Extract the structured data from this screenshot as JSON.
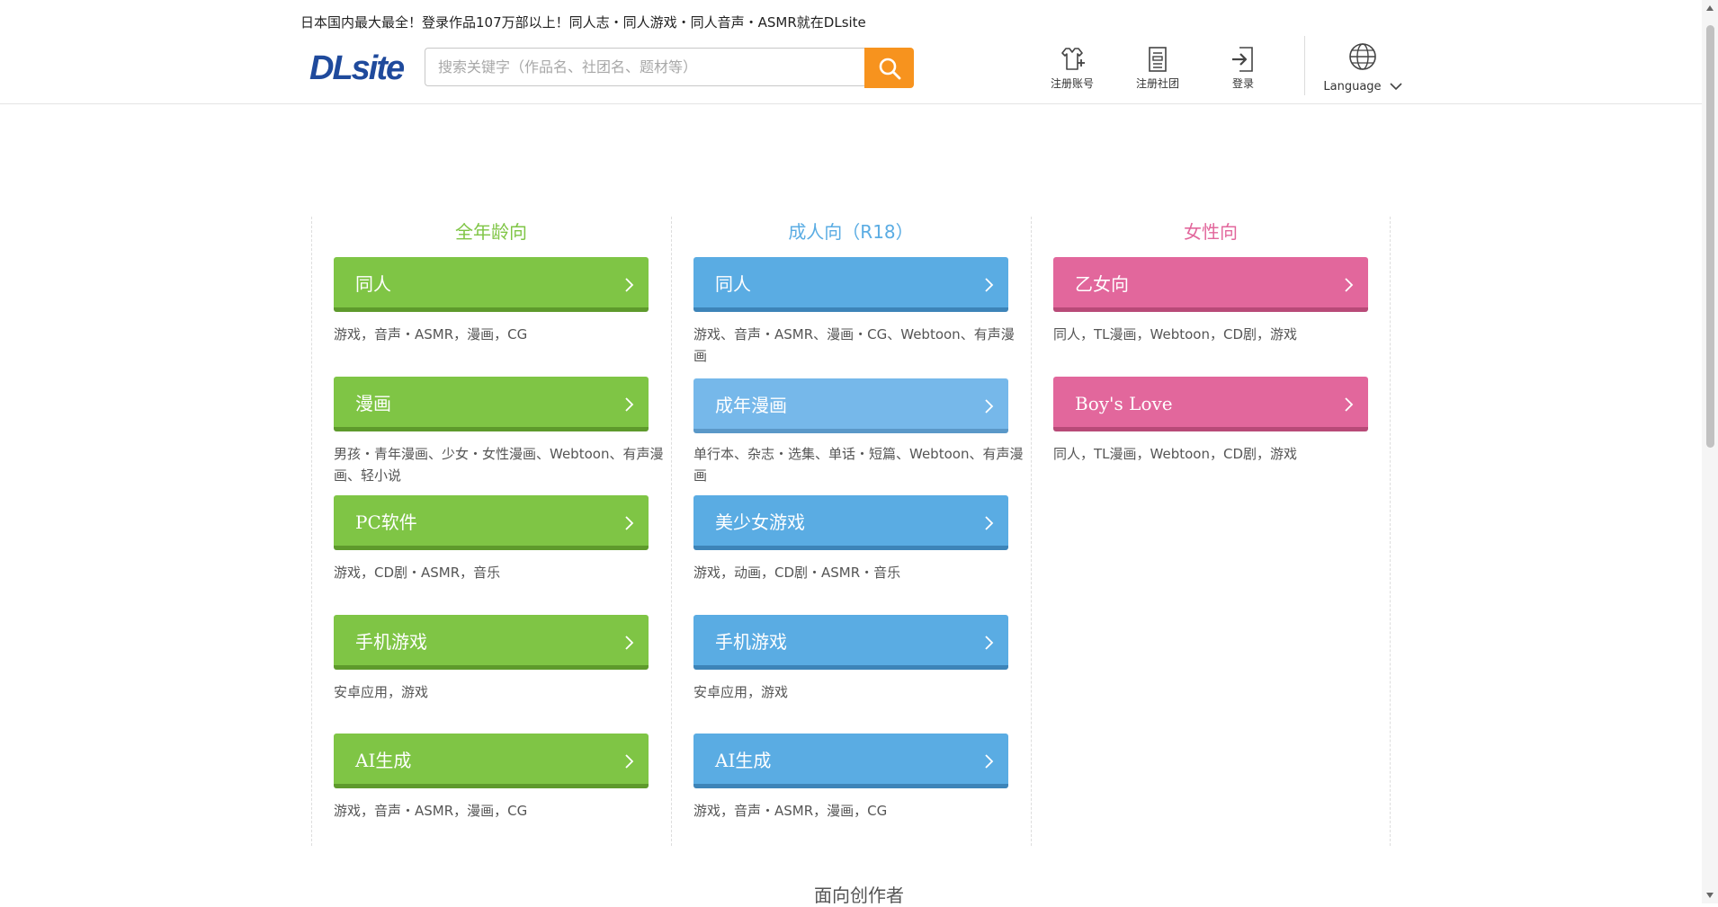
{
  "header": {
    "tagline": "日本国内最大最全！登录作品107万部以上！同人志・同人游戏・同人音声・ASMR就在DLsite",
    "logo_text": "DLsite",
    "search": {
      "placeholder": "搜索关键字（作品名、社团名、题材等）",
      "value": ""
    },
    "buttons": {
      "register_account": "注册账号",
      "register_circle": "注册社团",
      "login": "登录"
    },
    "language_label": "Language"
  },
  "columns": [
    {
      "title": "全年龄向",
      "title_color": "#7fc545",
      "items": [
        {
          "label": "同人",
          "desc": "游戏，音声・ASMR，漫画，CG"
        },
        {
          "label": "漫画",
          "desc": "男孩・青年漫画、少女・女性漫画、Webtoon、有声漫画、轻小说"
        },
        {
          "label": "PC软件",
          "desc": "游戏，CD剧・ASMR，音乐"
        },
        {
          "label": "手机游戏",
          "desc": "安卓应用，游戏"
        },
        {
          "label": "AI生成",
          "desc": "游戏，音声・ASMR，漫画，CG"
        }
      ]
    },
    {
      "title": "成人向（R18）",
      "title_color": "#5aace3",
      "items": [
        {
          "label": "同人",
          "desc": "游戏、音声・ASMR、漫画・CG、Webtoon、有声漫画"
        },
        {
          "label": "成年漫画",
          "desc": "单行本、杂志・选集、单话・短篇、Webtoon、有声漫画"
        },
        {
          "label": "美少女游戏",
          "desc": "游戏，动画，CD剧・ASMR・音乐"
        },
        {
          "label": "手机游戏",
          "desc": "安卓应用，游戏"
        },
        {
          "label": "AI生成",
          "desc": "游戏，音声・ASMR，漫画，CG"
        }
      ]
    },
    {
      "title": "女性向",
      "title_color": "#e2679c",
      "items": [
        {
          "label": "乙女向",
          "desc": "同人，TL漫画，Webtoon，CD剧，游戏"
        },
        {
          "label": "Boy's Love",
          "desc": "同人，TL漫画，Webtoon，CD剧，游戏"
        }
      ]
    }
  ],
  "creators_heading": "面向创作者",
  "colors": {
    "green": "#7fc545",
    "blue": "#5aace3",
    "light_blue": "#76b8ea",
    "pink": "#e2679c",
    "search_button": "#f7931e",
    "logo_blue": "#1f4a9c"
  },
  "icons": [
    "search-icon",
    "register-account-icon",
    "register-circle-icon",
    "login-icon",
    "globe-icon",
    "chevron-down-icon",
    "chevron-right-icon"
  ]
}
